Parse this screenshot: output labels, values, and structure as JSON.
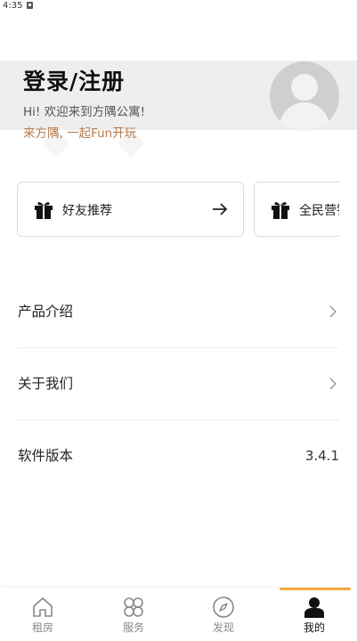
{
  "status_bar": {
    "time": "4:35",
    "notification_icon": "notification-icon"
  },
  "header": {
    "title": "登录/注册",
    "welcome": "Hi! 欢迎来到方隅公寓!",
    "slogan": "来方隅, 一起Fun开玩",
    "avatar_icon": "user-avatar-icon"
  },
  "cards": [
    {
      "label": "好友推荐",
      "icon": "gift-icon",
      "action_icon": "arrow-right-icon"
    },
    {
      "label": "全民营销",
      "icon": "gift-icon"
    }
  ],
  "menu": {
    "product_intro": "产品介绍",
    "about_us": "关于我们",
    "software_version": "软件版本",
    "version_value": "3.4.1"
  },
  "tabbar": {
    "tabs": [
      {
        "label": "租房",
        "icon": "home-icon"
      },
      {
        "label": "服务",
        "icon": "grid-icon"
      },
      {
        "label": "发现",
        "icon": "compass-icon"
      },
      {
        "label": "我的",
        "icon": "user-icon"
      }
    ],
    "active_index": 3,
    "accent_color": "#f2a93b"
  },
  "colors": {
    "slogan": "#b87a4b",
    "header_band": "#eeeeee"
  }
}
